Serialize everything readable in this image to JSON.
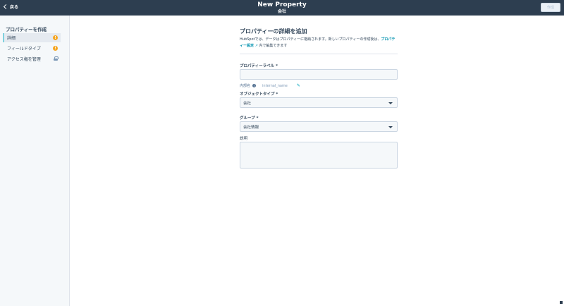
{
  "header": {
    "back_label": "戻る",
    "title": "New Property",
    "subtitle": "会社",
    "create_label": "作成"
  },
  "sidebar": {
    "title": "プロパティーを作成",
    "items": [
      {
        "label": "詳細",
        "badge": "!",
        "active": true
      },
      {
        "label": "フィールドタイプ",
        "badge": "!",
        "active": false
      },
      {
        "label": "アクセス権を管理",
        "icon": "lock-icon",
        "active": false
      }
    ]
  },
  "form": {
    "heading": "プロパティーの詳細を追加",
    "desc_prefix": "HubSpotでは、データはプロパティーに格納されます。新しいプロパティーの作成後は、",
    "desc_link": "プロパティー設定",
    "desc_suffix": "内で編集できます",
    "label_field": {
      "label": "プロパティーラベル *",
      "value": ""
    },
    "internal_name": {
      "label": "内部名",
      "value": "internal_name"
    },
    "object_type": {
      "label": "オブジェクトタイプ *",
      "value": "会社"
    },
    "group": {
      "label": "グループ *",
      "value": "会社情報"
    },
    "description": {
      "label": "説明",
      "value": ""
    }
  },
  "colors": {
    "header_bg": "#2d3e50",
    "sidebar_bg": "#f5f8fa",
    "accent": "#0091ae",
    "warning_badge": "#f5a623"
  }
}
